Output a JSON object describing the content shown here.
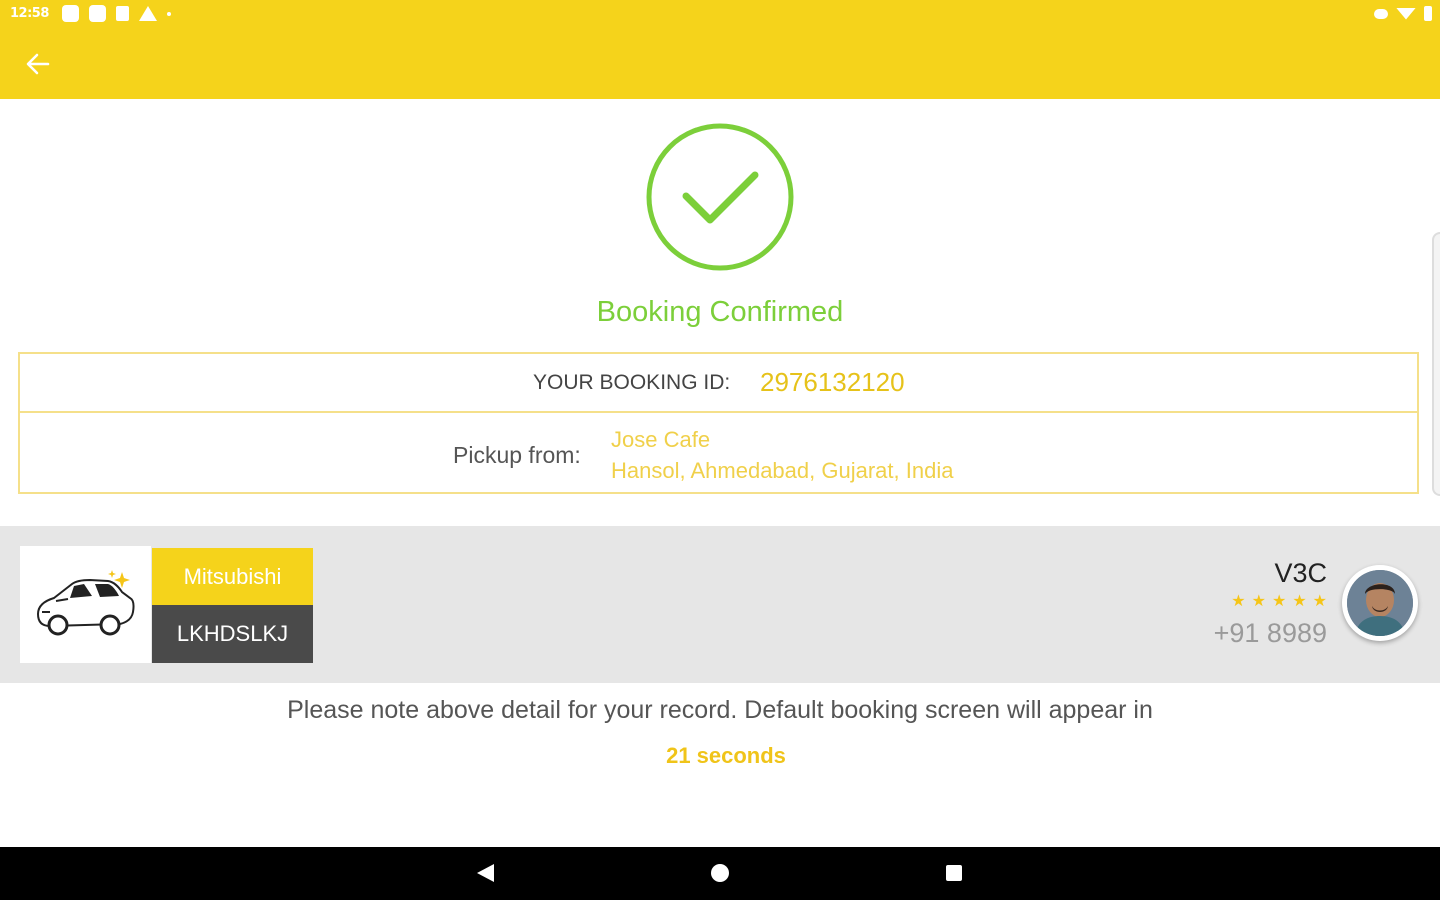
{
  "status_bar": {
    "time": "12:58"
  },
  "colors": {
    "brand": "#f5d31b",
    "success": "#7ccf3a",
    "accent_text": "#e6c21a",
    "plate_bg": "#4a4a4a",
    "strip_bg": "#e6e6e6"
  },
  "confirmation": {
    "title": "Booking Confirmed"
  },
  "booking": {
    "id_label": "YOUR BOOKING ID:",
    "id_value": "2976132120",
    "pickup_label": "Pickup from:",
    "pickup_name": "Jose Cafe",
    "pickup_address": "Hansol, Ahmedabad, Gujarat, India"
  },
  "vehicle": {
    "make": "Mitsubishi",
    "plate": "LKHDSLKJ"
  },
  "driver": {
    "name": "V3C",
    "rating": 5,
    "phone": "+91 8989"
  },
  "note": {
    "text": "Please note above detail for your record. Default booking screen will appear in",
    "countdown": "21 seconds"
  },
  "icons": {
    "back": "arrow-left-icon",
    "check": "check-circle-icon",
    "car": "car-icon"
  }
}
